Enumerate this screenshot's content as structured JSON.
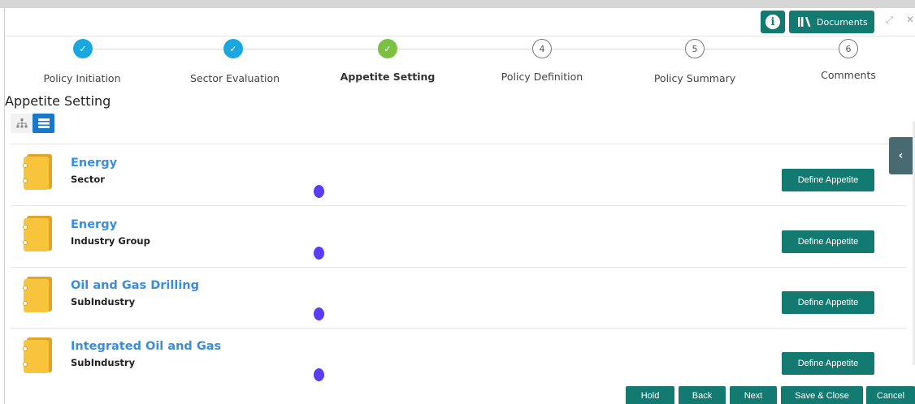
{
  "toolbar": {
    "info_icon": "info-icon",
    "documents_label": "Documents",
    "documents_icon": "library-icon"
  },
  "stepper": {
    "steps": [
      {
        "number": "1",
        "label": "Policy Initiation",
        "status": "done"
      },
      {
        "number": "2",
        "label": "Sector Evaluation",
        "status": "done"
      },
      {
        "number": "3",
        "label": "Appetite Setting",
        "status": "active"
      },
      {
        "number": "4",
        "label": "Policy Definition",
        "status": "pending"
      },
      {
        "number": "5",
        "label": "Policy Summary",
        "status": "pending"
      },
      {
        "number": "6",
        "label": "Comments",
        "status": "pending"
      }
    ],
    "check_glyph": "✓"
  },
  "page": {
    "title": "Appetite Setting"
  },
  "items": [
    {
      "name": "Energy",
      "type": "Sector",
      "action": "Define Appetite"
    },
    {
      "name": "Energy",
      "type": "Industry Group",
      "action": "Define Appetite"
    },
    {
      "name": "Oil and Gas Drilling",
      "type": "SubIndustry",
      "action": "Define Appetite"
    },
    {
      "name": "Integrated Oil and Gas",
      "type": "SubIndustry",
      "action": "Define Appetite"
    }
  ],
  "footer": {
    "hold": "Hold",
    "back": "Back",
    "next": "Next",
    "save_close": "Save & Close",
    "cancel": "Cancel"
  },
  "colors": {
    "primary_button": "#127a70",
    "step_done": "#1aa7e0",
    "step_active": "#7cc142",
    "item_link": "#3a8dde",
    "status_dot": "#5b3df5",
    "folder": "#f7c43c"
  }
}
